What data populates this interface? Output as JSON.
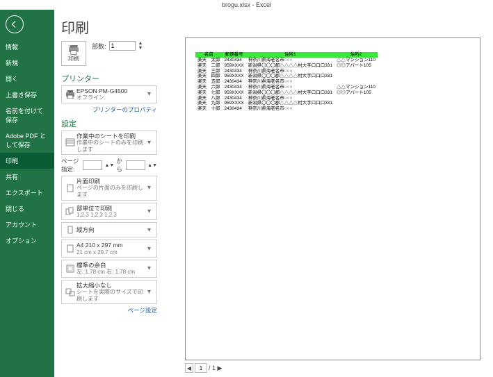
{
  "titlebar": "brogu.xlsx - Excel",
  "nav": {
    "items": [
      {
        "label": "情報",
        "active": false
      },
      {
        "label": "新規",
        "active": false
      },
      {
        "label": "開く",
        "active": false
      },
      {
        "label": "上書き保存",
        "active": false
      },
      {
        "label": "名前を付けて保存",
        "active": false
      },
      {
        "label": "Adobe PDF として保存",
        "active": false
      },
      {
        "label": "印刷",
        "active": true
      },
      {
        "label": "共有",
        "active": false
      },
      {
        "label": "エクスポート",
        "active": false
      },
      {
        "label": "閉じる",
        "active": false
      },
      {
        "label": "アカウント",
        "active": false
      },
      {
        "label": "オプション",
        "active": false
      }
    ]
  },
  "page": {
    "title": "印刷",
    "print_btn": "印刷",
    "copies_label": "部数:",
    "copies_value": "1",
    "sections": {
      "printer": "プリンター",
      "settings": "設定"
    },
    "printer": {
      "name": "EPSON PM-G4500",
      "status": "オフライン"
    },
    "printer_props": "プリンターのプロパティ",
    "page_range": {
      "label": "ページ指定:",
      "sep": "から"
    },
    "drops": {
      "sheets": {
        "t1": "作業中のシートを印刷",
        "t2": "作業中のシートのみを印刷します"
      },
      "sides": {
        "t1": "片面印刷",
        "t2": "ページの片面のみを印刷します"
      },
      "collate": {
        "t1": "部単位で印刷",
        "t2": "1,2,3   1,2,3   1,2,3"
      },
      "orient": {
        "t1": "縦方向",
        "t2": ""
      },
      "paper": {
        "t1": "A4 210 x 297 mm",
        "t2": "21 cm x 29.7 cm"
      },
      "margin": {
        "t1": "標準の余白",
        "t2": "左: 1.78 cm   右: 1.78 cm"
      },
      "scale": {
        "t1": "拡大縮小なし",
        "t2": "シートを実際のサイズで印刷します"
      }
    },
    "page_setup": "ページ設定",
    "footer": {
      "page_current": "1",
      "page_label": "/ 1 ▶"
    }
  },
  "chart_data": {
    "type": "table",
    "headers": [
      "名前",
      "郵便番号",
      "住所1",
      "住所2"
    ],
    "rows": [
      [
        "楽天　太郎",
        "2430434",
        "神奈川県海老名市○○○",
        "△△マンション110"
      ],
      [
        "楽天　二郎",
        "959XXXX",
        "新潟県〇〇〇郡△△△△村大字口口口331",
        "◎◎アパート105"
      ],
      [
        "楽天　三郎",
        "2430434",
        "神奈川県海老名市○○○",
        ""
      ],
      [
        "楽天　四郎",
        "959XXXX",
        "新潟県〇〇〇郡△△△△村大字口口口331",
        ""
      ],
      [
        "楽天　五郎",
        "2430434",
        "神奈川県海老名市○○○",
        ""
      ],
      [
        "楽天　六郎",
        "2430434",
        "神奈川県海老名市○○○",
        "△△マンション110"
      ],
      [
        "楽天　七郎",
        "959XXXX",
        "新潟県〇〇〇郡△△△△村大字口口口331",
        "◎◎アパート105"
      ],
      [
        "楽天　八郎",
        "2430434",
        "神奈川県海老名市○○○",
        ""
      ],
      [
        "楽天　九郎",
        "959XXXX",
        "新潟県〇〇〇郡△△△△村大字口口口331",
        ""
      ],
      [
        "楽天　十郎",
        "2430434",
        "神奈川県海老名市○○○",
        ""
      ]
    ]
  }
}
